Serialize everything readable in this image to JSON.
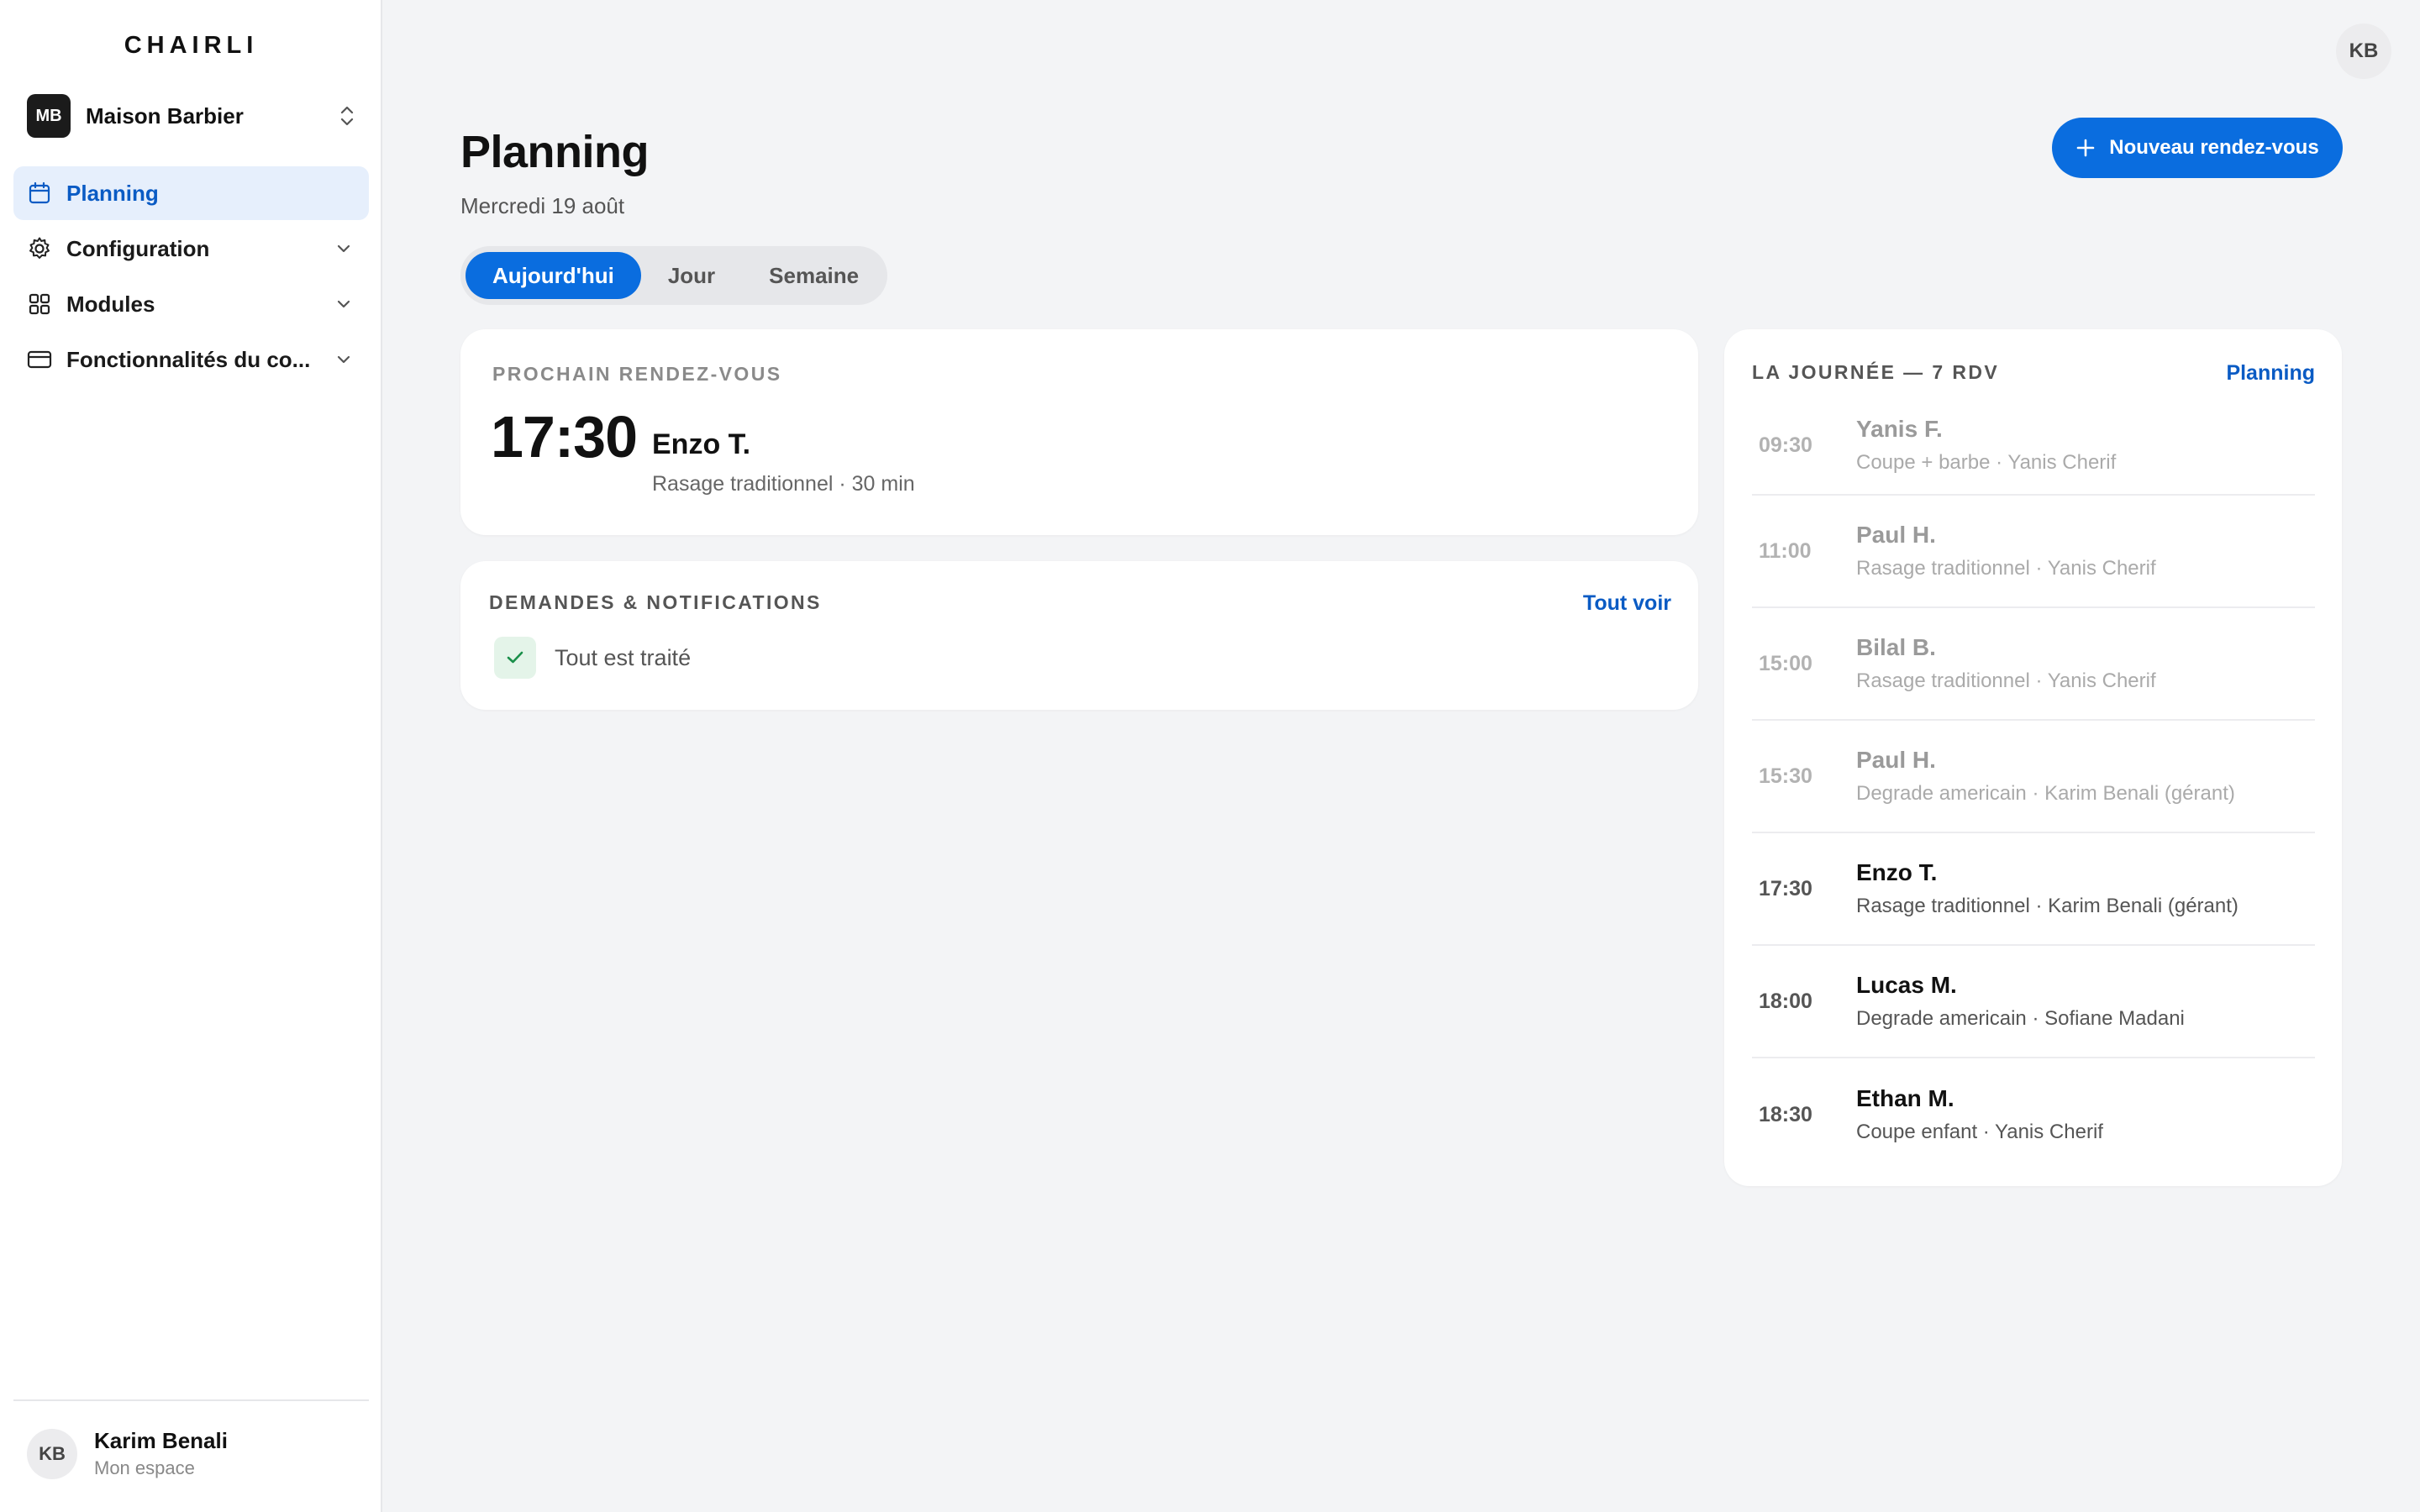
{
  "brand": "CHAIRLI",
  "business": {
    "initials": "MB",
    "name": "Maison Barbier"
  },
  "nav": [
    {
      "label": "Planning",
      "icon": "calendar-icon",
      "active": true
    },
    {
      "label": "Configuration",
      "icon": "gear-icon"
    },
    {
      "label": "Modules",
      "icon": "grid-icon"
    },
    {
      "label": "Fonctionnalités du co...",
      "icon": "card-icon"
    }
  ],
  "user": {
    "initials": "KB",
    "name": "Karim Benali",
    "subtitle": "Mon espace"
  },
  "header": {
    "title": "Planning",
    "date": "Mercredi 19 août",
    "new_button": "Nouveau rendez-vous"
  },
  "tabs": [
    {
      "label": "Aujourd'hui",
      "active": true
    },
    {
      "label": "Jour"
    },
    {
      "label": "Semaine"
    }
  ],
  "next_appointment": {
    "eyebrow": "PROCHAIN RENDEZ-VOUS",
    "time": "17:30",
    "client": "Enzo T.",
    "service": "Rasage traditionnel · 30 min"
  },
  "requests": {
    "eyebrow": "DEMANDES & NOTIFICATIONS",
    "link": "Tout voir",
    "status": "Tout est traité"
  },
  "day": {
    "eyebrow": "LA JOURNÉE — 7 RDV",
    "link": "Planning",
    "appointments": [
      {
        "time": "09:30",
        "client": "Yanis F.",
        "details": "Coupe + barbe · Yanis Cherif",
        "past": true
      },
      {
        "time": "11:00",
        "client": "Paul H.",
        "details": "Rasage traditionnel · Yanis Cherif",
        "past": true
      },
      {
        "time": "15:00",
        "client": "Bilal B.",
        "details": "Rasage traditionnel · Yanis Cherif",
        "past": true
      },
      {
        "time": "15:30",
        "client": "Paul H.",
        "details": "Degrade americain · Karim Benali (gérant)",
        "past": true
      },
      {
        "time": "17:30",
        "client": "Enzo T.",
        "details": "Rasage traditionnel · Karim Benali (gérant)",
        "past": false
      },
      {
        "time": "18:00",
        "client": "Lucas M.",
        "details": "Degrade americain · Sofiane Madani",
        "past": false
      },
      {
        "time": "18:30",
        "client": "Ethan M.",
        "details": "Coupe enfant · Yanis Cherif",
        "past": false
      }
    ]
  },
  "colors": {
    "accent": "#0a6ddf",
    "link": "#0a5bc4",
    "success": "#1a8f4a"
  }
}
